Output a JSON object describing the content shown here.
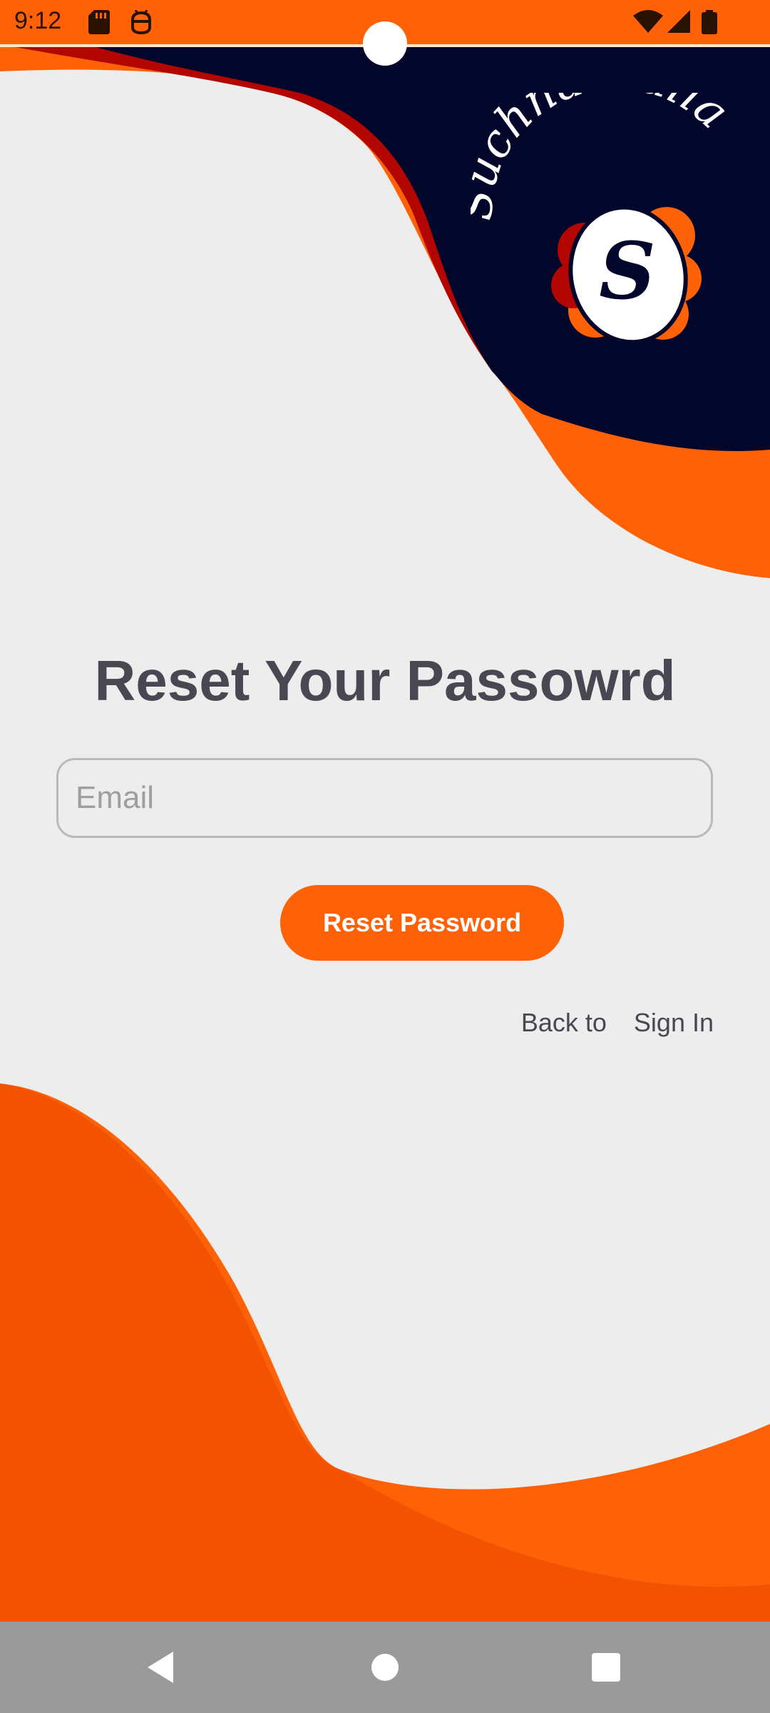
{
  "status_bar": {
    "time": "9:12",
    "left_icons": [
      "sd-card-icon",
      "android-debug-icon"
    ],
    "right_icons": [
      "wifi-icon",
      "cell-signal-icon",
      "battery-icon"
    ]
  },
  "brand": {
    "logo_text": "Suchna walla",
    "logo_letter": "S",
    "colors": {
      "orange": "#ff6106",
      "navy": "#02062a",
      "red": "#b30600",
      "background": "#ededed"
    }
  },
  "page": {
    "title": "Reset Your Passowrd"
  },
  "form": {
    "email_placeholder": "Email",
    "email_value": "",
    "reset_button_label": "Reset Password",
    "back_prefix": "Back to",
    "sign_in_link": "Sign In"
  },
  "nav_bar": {
    "buttons": [
      "back-triangle-icon",
      "home-circle-icon",
      "recents-square-icon"
    ]
  }
}
